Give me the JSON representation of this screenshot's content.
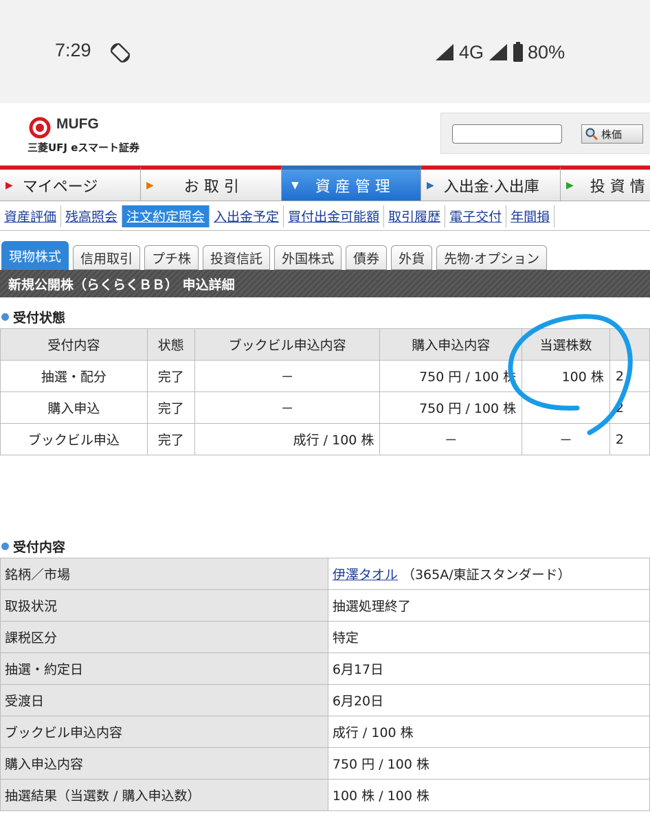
{
  "status_bar": {
    "time": "7:29",
    "network": "4G",
    "battery": "80%"
  },
  "header": {
    "logo_text": "MUFG",
    "logo_sub": "三菱UFJ eスマート証券",
    "search_placeholder": "",
    "search_button": "株価"
  },
  "nav": {
    "items": [
      {
        "label": "マイページ"
      },
      {
        "label": "お 取 引"
      },
      {
        "label": "資 産 管 理"
      },
      {
        "label": "入出金·入出庫"
      },
      {
        "label": "投 資 情"
      }
    ]
  },
  "subnav": {
    "items": [
      "資産評価",
      "残高照会",
      "注文約定照会",
      "入出金予定",
      "買付出金可能額",
      "取引履歴",
      "電子交付",
      "年間損"
    ]
  },
  "tabs": [
    "現物株式",
    "信用取引",
    "プチ株",
    "投資信託",
    "外国株式",
    "債券",
    "外貨",
    "先物·オプション"
  ],
  "title": "新規公開株（らくらくＢＢ） 申込詳細",
  "reception_status": {
    "heading": "受付状態",
    "headers": [
      "受付内容",
      "状態",
      "ブックビル申込内容",
      "購入申込内容",
      "当選株数",
      ""
    ],
    "rows": [
      [
        "抽選・配分",
        "完了",
        "－",
        "750 円 / 100 株",
        "100 株",
        "2"
      ],
      [
        "購入申込",
        "完了",
        "－",
        "750 円 / 100 株",
        "",
        "2"
      ],
      [
        "ブックビル申込",
        "完了",
        "成行 / 100 株",
        "－",
        "－",
        "2"
      ]
    ]
  },
  "reception_detail": {
    "heading": "受付内容",
    "stock_link": "伊澤タオル",
    "stock_market": "（365A/東証スタンダード）",
    "rows": [
      {
        "label": "銘柄／市場"
      },
      {
        "label": "取扱状況",
        "value": "抽選処理終了"
      },
      {
        "label": "課税区分",
        "value": "特定"
      },
      {
        "label": "抽選・約定日",
        "value": "6月17日"
      },
      {
        "label": "受渡日",
        "value": "6月20日"
      },
      {
        "label": "ブックビル申込内容",
        "value": "成行 / 100 株"
      },
      {
        "label": "購入申込内容",
        "value": "750 円 / 100 株"
      },
      {
        "label": "抽選結果（当選数 / 購入申込数）",
        "value": "100 株 / 100 株"
      }
    ]
  },
  "colors": {
    "accent_red": "#d71921",
    "accent_blue": "#2f86d9",
    "annotation": "#1a9be8",
    "link": "#1a3b9a"
  }
}
